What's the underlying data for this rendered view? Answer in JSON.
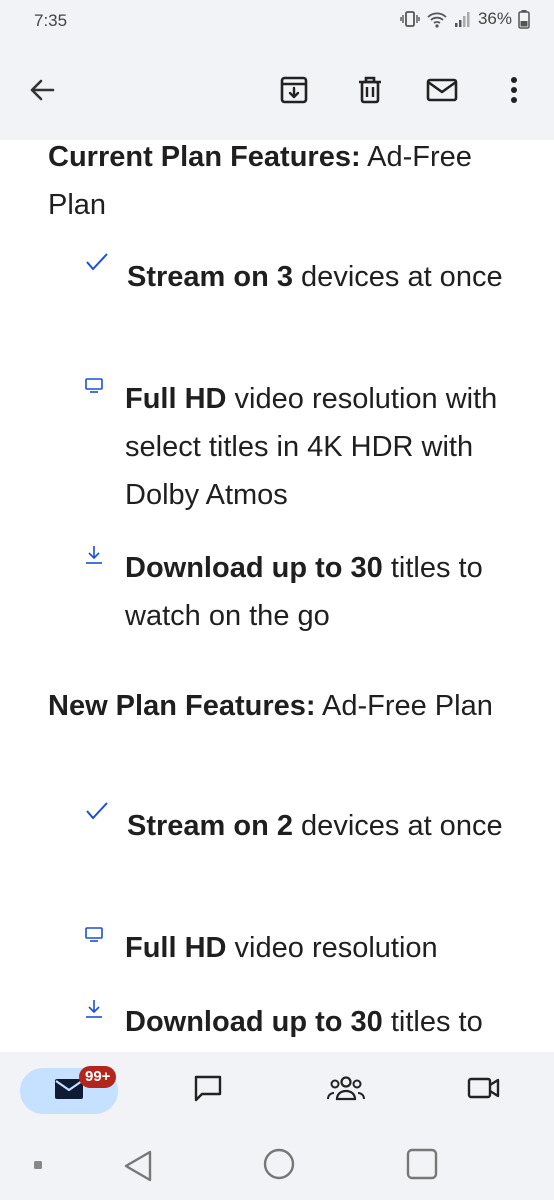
{
  "status_bar": {
    "time": "7:35",
    "battery_percent": "36%",
    "icons": [
      "vibrate-icon",
      "wifi-icon",
      "signal-icon",
      "battery-icon"
    ]
  },
  "app_bar": {
    "actions": [
      "back-arrow-icon",
      "archive-icon",
      "delete-icon",
      "mark-unread-icon",
      "more-options-icon"
    ]
  },
  "current_plan": {
    "heading_bold": "Current Plan Features:",
    "heading_rest": " Ad-Free Plan",
    "features": [
      {
        "icon": "checkmark-icon",
        "bold": "Stream on 3",
        "rest": " devices at once"
      },
      {
        "icon": "monitor-icon",
        "bold": "Full HD",
        "rest": " video resolution with select titles in 4K HDR with Dolby Atmos"
      },
      {
        "icon": "download-icon",
        "bold": "Download up to 30",
        "rest": " titles to watch on the go"
      }
    ]
  },
  "new_plan": {
    "heading_bold": "New Plan Features:",
    "heading_rest": " Ad-Free Plan",
    "features": [
      {
        "icon": "checkmark-icon",
        "bold": "Stream on 2",
        "rest": " devices at once"
      },
      {
        "icon": "monitor-icon",
        "bold": "Full HD",
        "rest": " video resolution"
      },
      {
        "icon": "download-icon",
        "bold": "Download up to 30",
        "rest": " titles to"
      }
    ]
  },
  "bottom_nav": {
    "mail_badge": "99+",
    "items": [
      "mail-icon",
      "chat-icon",
      "spaces-icon",
      "meet-icon"
    ]
  },
  "colors": {
    "accent": "#1a4fd6",
    "bar_bg": "#f1f3f6",
    "badge": "#b3261e",
    "active_pill": "#c6e0ff"
  }
}
